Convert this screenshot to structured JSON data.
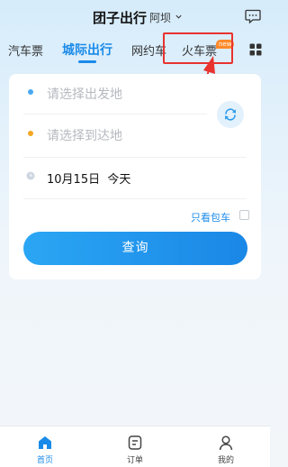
{
  "header": {
    "title": "团子出行",
    "city": "阿坝"
  },
  "tabs": [
    {
      "label": "汽车票"
    },
    {
      "label": "城际出行"
    },
    {
      "label": "网约车"
    },
    {
      "label": "火车票",
      "badge": "new"
    }
  ],
  "form": {
    "from_placeholder": "请选择出发地",
    "to_placeholder": "请选择到达地",
    "date": "10月15日",
    "day": "今天",
    "only_charter_label": "只看包车",
    "search_label": "查询"
  },
  "bottom_nav": [
    {
      "label": "首页"
    },
    {
      "label": "订单"
    },
    {
      "label": "我的"
    }
  ],
  "colors": {
    "accent": "#1a8ae8",
    "from_dot": "#4aa8f0",
    "to_dot": "#f5a623",
    "badge": "#ff8a2a",
    "annotation": "#e8332f"
  },
  "icons": {
    "message": "message-icon",
    "more": "grid-icon",
    "swap": "swap-icon",
    "home": "home-icon",
    "order": "order-icon",
    "profile": "profile-icon"
  }
}
